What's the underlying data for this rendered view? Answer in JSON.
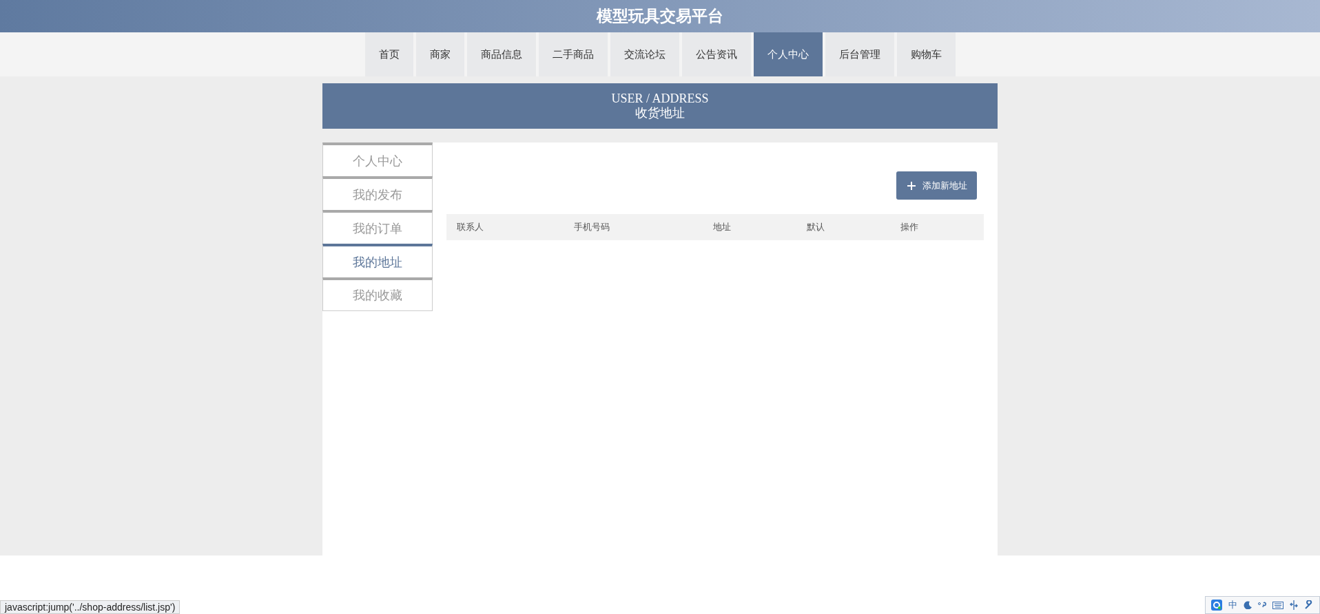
{
  "site_title": "模型玩具交易平台",
  "nav": [
    {
      "label": "首页",
      "selected": false
    },
    {
      "label": "商家",
      "selected": false
    },
    {
      "label": "商品信息",
      "selected": false
    },
    {
      "label": "二手商品",
      "selected": false
    },
    {
      "label": "交流论坛",
      "selected": false
    },
    {
      "label": "公告资讯",
      "selected": false
    },
    {
      "label": "个人中心",
      "selected": true
    },
    {
      "label": "后台管理",
      "selected": false
    },
    {
      "label": "购物车",
      "selected": false
    }
  ],
  "banner": {
    "title": "USER / ADDRESS",
    "subtitle": "收货地址"
  },
  "sidebar": {
    "items": [
      {
        "label": "个人中心",
        "selected": false
      },
      {
        "label": "我的发布",
        "selected": false
      },
      {
        "label": "我的订单",
        "selected": false
      },
      {
        "label": "我的地址",
        "selected": true
      },
      {
        "label": "我的收藏",
        "selected": false
      }
    ]
  },
  "add_button": "添加新地址",
  "table": {
    "columns": [
      "联系人",
      "手机号码",
      "地址",
      "默认",
      "操作"
    ]
  },
  "status_bar": "javascript:jump('../shop-address/list.jsp')",
  "ime_bar": {
    "mode": "中"
  }
}
